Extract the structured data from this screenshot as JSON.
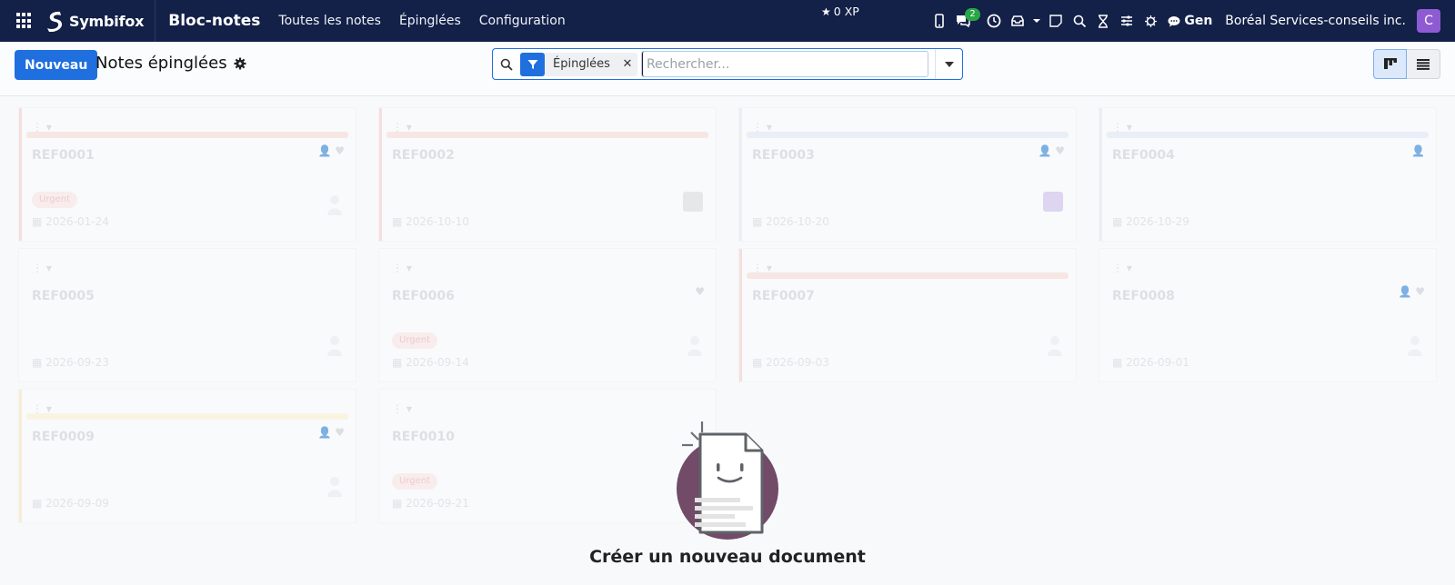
{
  "navbar": {
    "brand": "Symbifox",
    "app_title": "Bloc-notes",
    "menu": [
      "Toutes les notes",
      "Épinglées",
      "Configuration"
    ],
    "xp": "0 XP",
    "chat_badge": "2",
    "gen_label": "Gen",
    "company": "Boréal Services-conseils inc.",
    "avatar_letter": "C"
  },
  "control": {
    "new_button": "Nouveau",
    "breadcrumb": "Notes épinglées",
    "facet_label": "Épinglées",
    "search_placeholder": "Rechercher..."
  },
  "cards": [
    {
      "ref": "REF0001",
      "date": "2026-01-24",
      "tag": "Urgent",
      "color": "#e8553b"
    },
    {
      "ref": "REF0002",
      "date": "2026-10-10",
      "tag": "",
      "color": "#e8553b"
    },
    {
      "ref": "REF0003",
      "date": "2026-10-20",
      "tag": "",
      "color": "#5b8fd9"
    },
    {
      "ref": "REF0004",
      "date": "2026-10-29",
      "tag": "",
      "color": "#5b8fd9"
    },
    {
      "ref": "REF0005",
      "date": "2026-09-23",
      "tag": "",
      "color": ""
    },
    {
      "ref": "REF0006",
      "date": "2026-09-14",
      "tag": "Urgent",
      "color": ""
    },
    {
      "ref": "REF0007",
      "date": "2026-09-03",
      "tag": "",
      "color": "#e8553b"
    },
    {
      "ref": "REF0008",
      "date": "2026-09-01",
      "tag": "",
      "color": ""
    },
    {
      "ref": "REF0009",
      "date": "2026-09-09",
      "tag": "",
      "color": "#f0c24b"
    },
    {
      "ref": "REF0010",
      "date": "2026-09-21",
      "tag": "Urgent",
      "color": ""
    }
  ],
  "empty_state": {
    "title": "Créer un nouveau document"
  }
}
